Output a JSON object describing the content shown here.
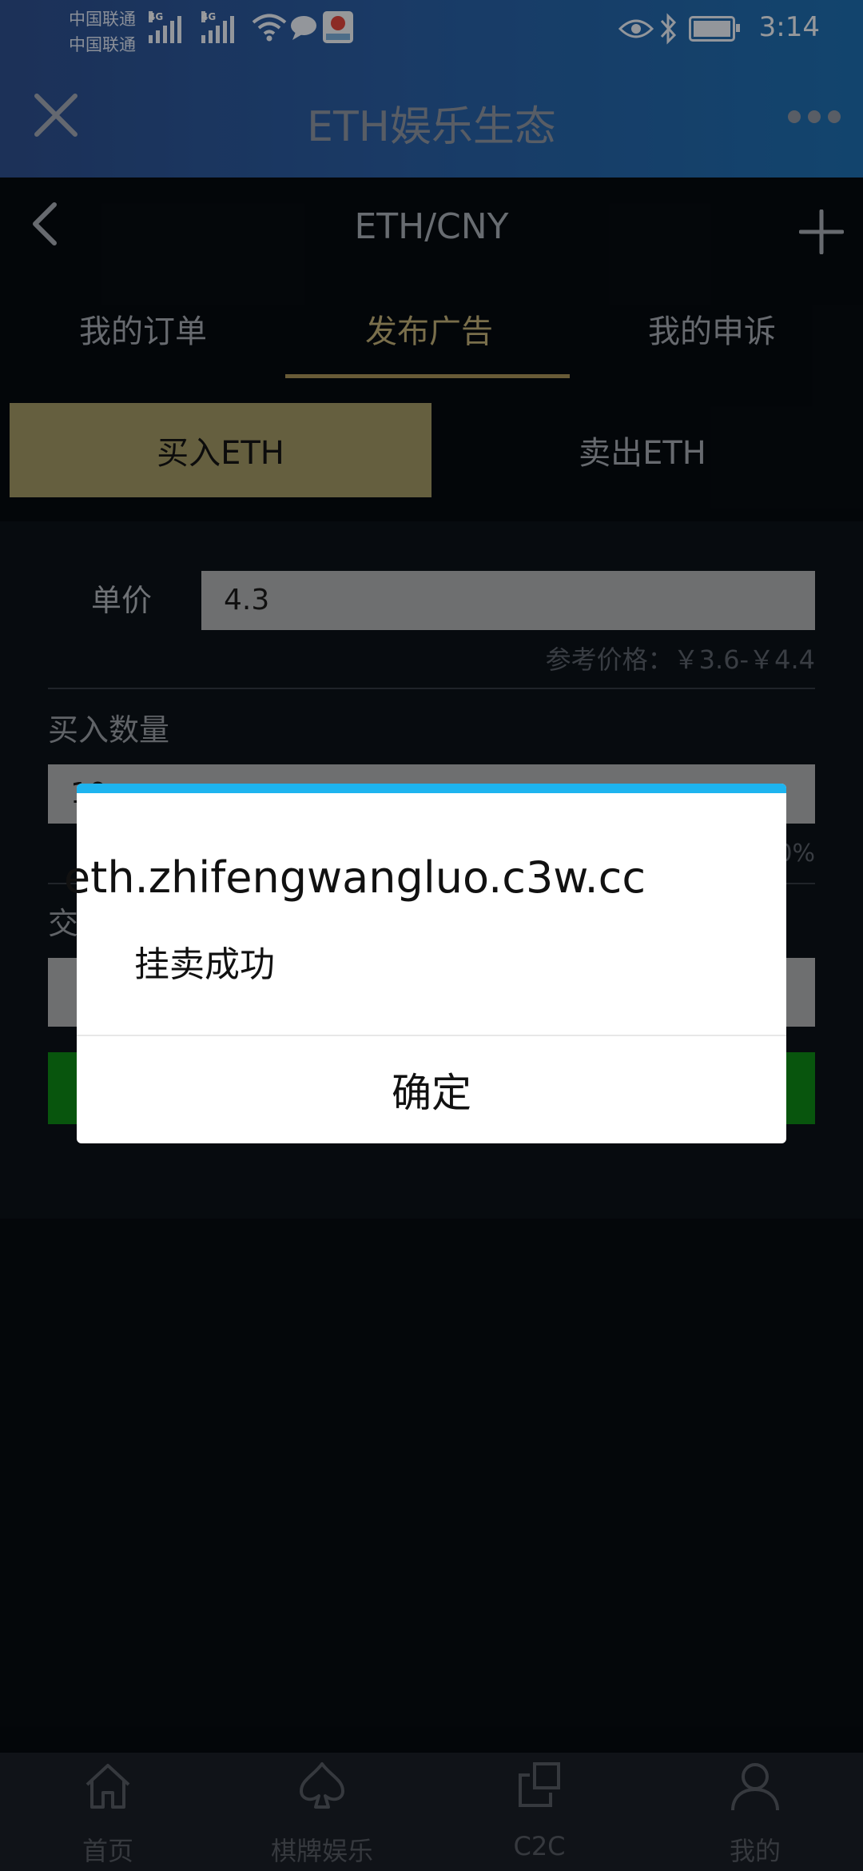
{
  "status_bar": {
    "carrier_1": "中国联通",
    "carrier_2": "中国联通",
    "network_1": "4G",
    "network_2": "4G",
    "battery_level": 0.9,
    "time": "3:14",
    "icons": [
      "signal-icon",
      "wifi-icon",
      "message-icon",
      "app-badge-icon",
      "eye-icon",
      "bluetooth-icon",
      "battery-icon"
    ]
  },
  "app_bar": {
    "title": "ETH娱乐生态",
    "close_icon": "close-icon",
    "more_icon": "more-dots-icon"
  },
  "page_header": {
    "title": "ETH/CNY",
    "back_icon": "chevron-left-icon",
    "add_icon": "plus-icon"
  },
  "tabs": [
    {
      "label": "我的订单",
      "active": false
    },
    {
      "label": "发布广告",
      "active": true
    },
    {
      "label": "我的申诉",
      "active": false
    }
  ],
  "trade_toggle": {
    "buy_label": "买入ETH",
    "sell_label": "卖出ETH",
    "selected": "buy"
  },
  "form": {
    "price_label": "单价",
    "price_value": "4.3",
    "reference_price": "参考价格：￥3.6-￥4.4",
    "quantity_label": "买入数量",
    "quantity_value": "10",
    "quantity_hint": "0%",
    "trade_label_partial": "交"
  },
  "dialog": {
    "host": "eth.zhifengwangluo.c3w.cc",
    "message": "挂卖成功",
    "ok_label": "确定",
    "accent_color": "#1eb4ef"
  },
  "bottom_nav": [
    {
      "label": "首页",
      "icon": "home-icon"
    },
    {
      "label": "棋牌娱乐",
      "icon": "spade-icon"
    },
    {
      "label": "C2C",
      "icon": "c2c-icon"
    },
    {
      "label": "我的",
      "icon": "user-icon"
    }
  ],
  "colors": {
    "accent_gold": "#a49a66",
    "active_tab": "#c4b27a",
    "submit_green": "#0d8a16",
    "header_blue": "#2a5ea4"
  }
}
